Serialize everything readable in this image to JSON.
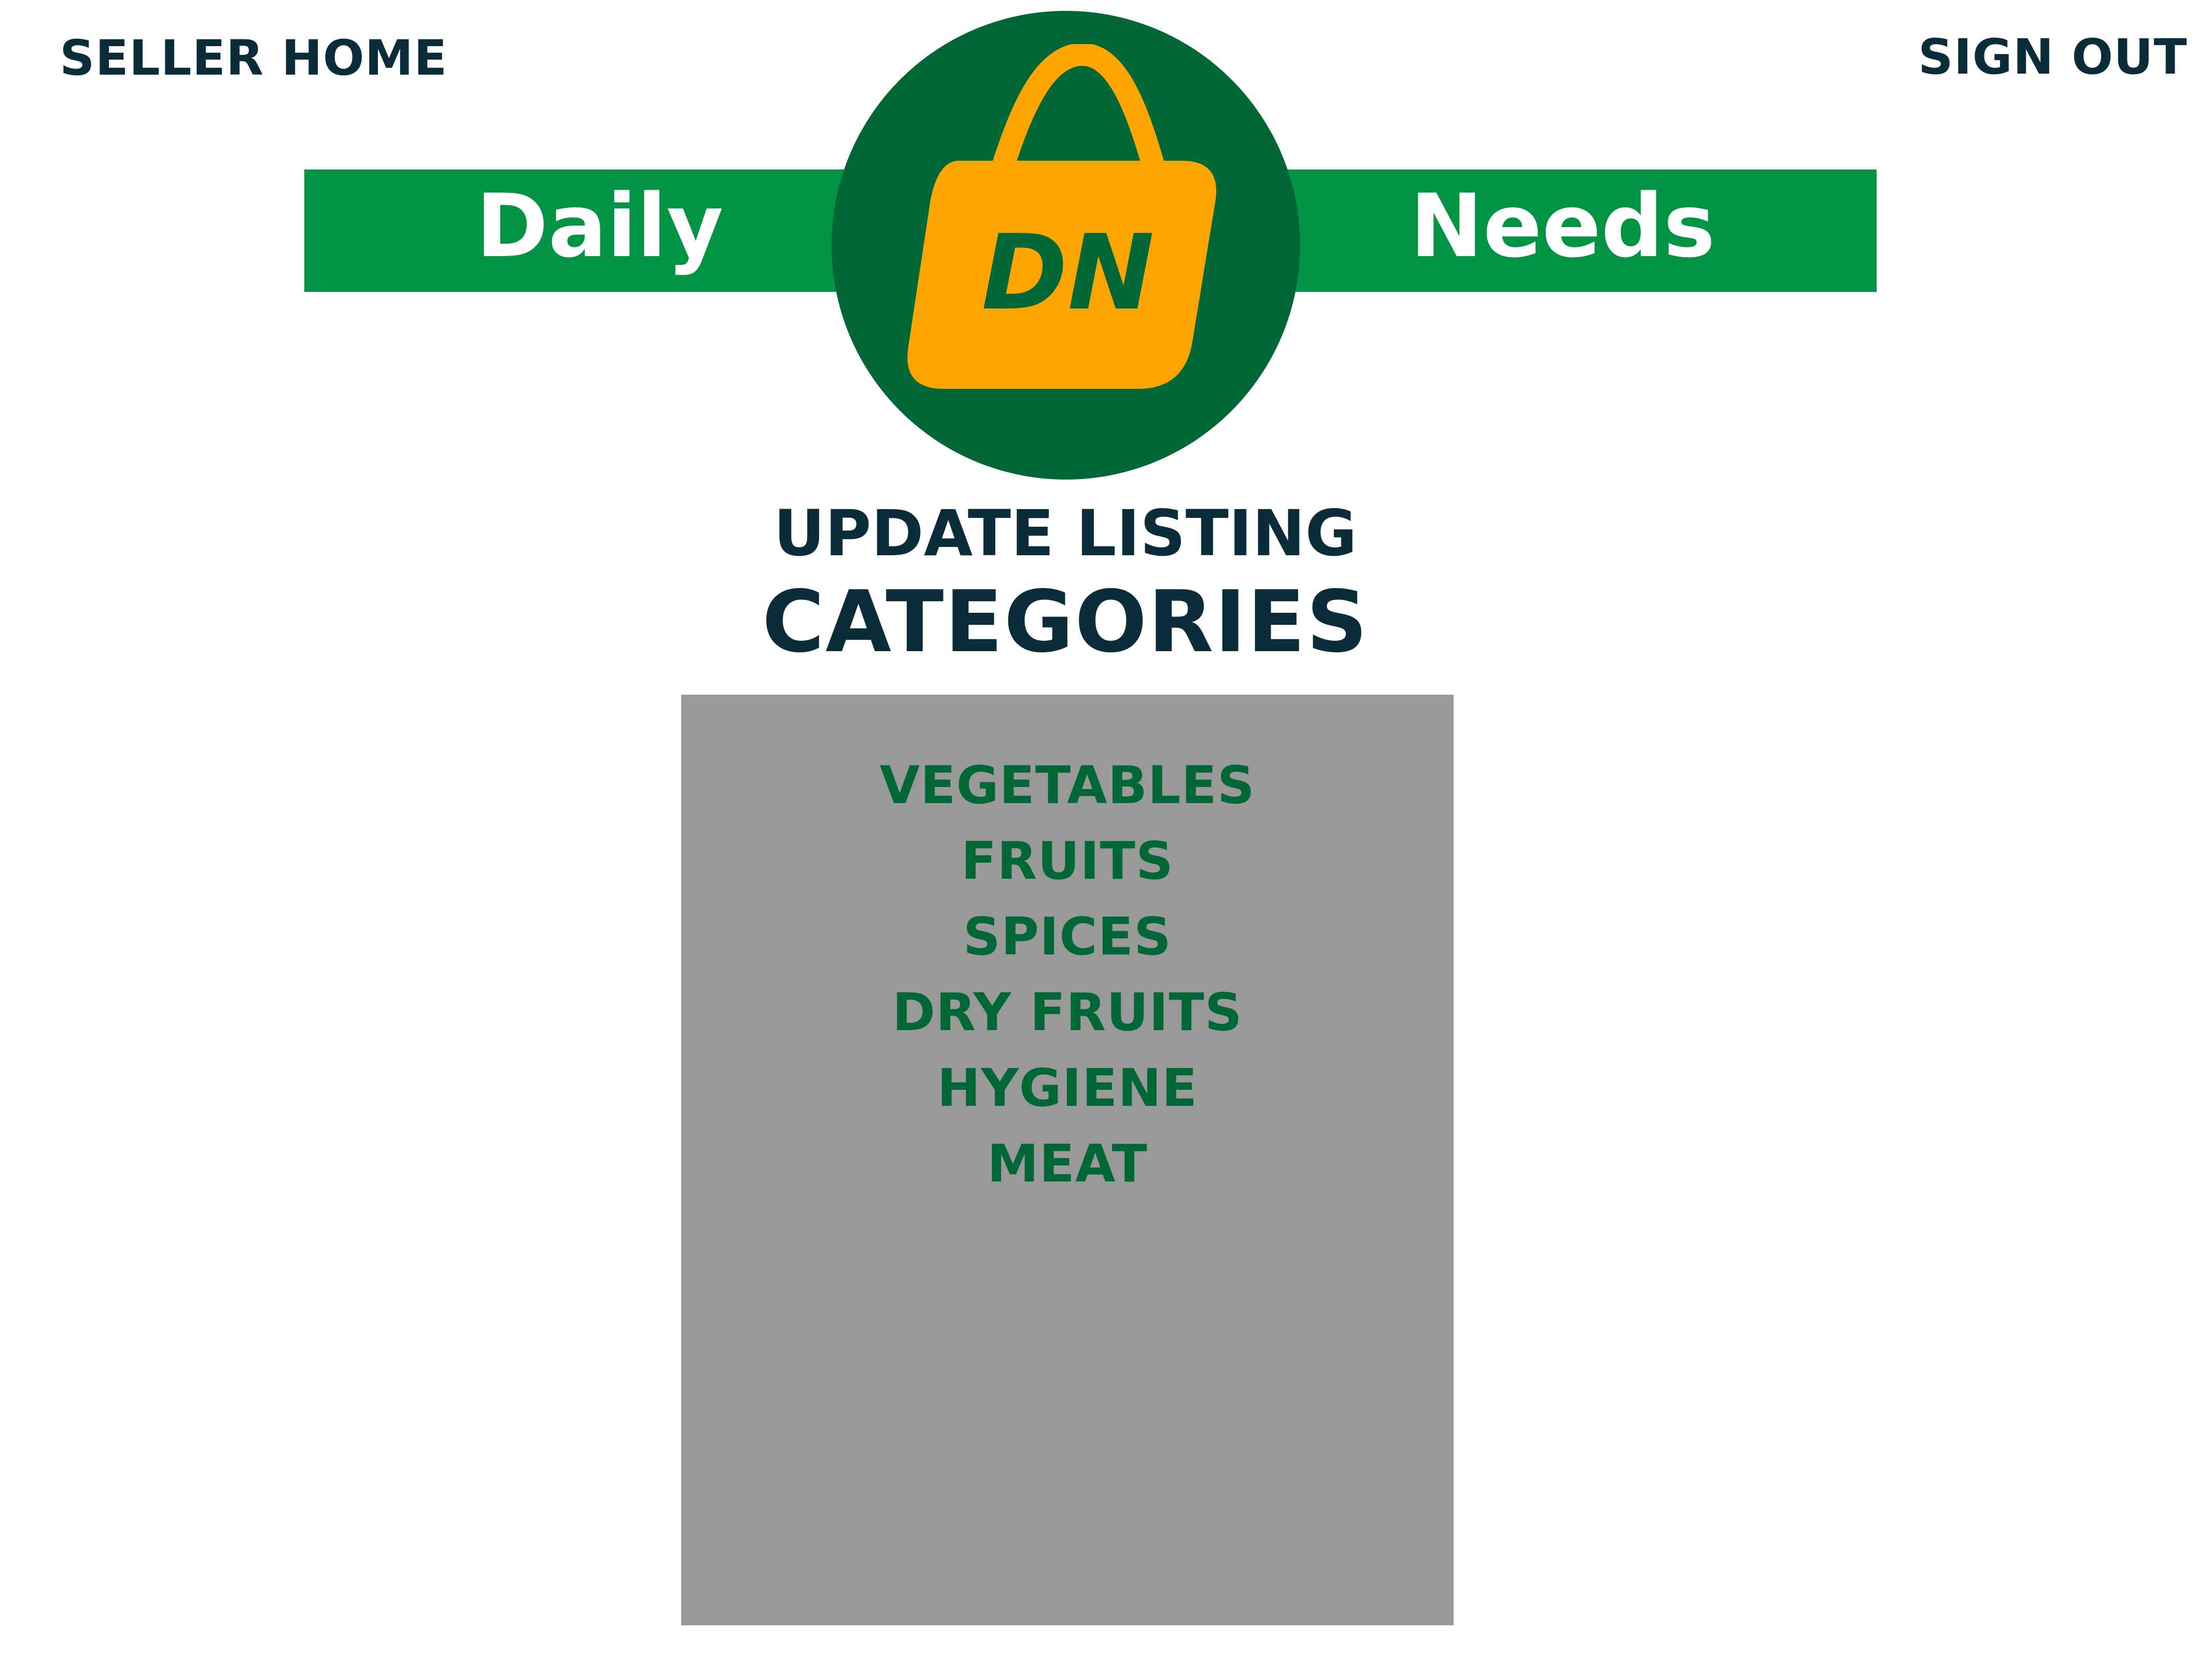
{
  "header": {
    "seller_home_label": "SELLER HOME",
    "sign_out_label": "SIGN OUT"
  },
  "brand": {
    "left_word": "Daily",
    "right_word": "Needs",
    "logo_initials": "DN",
    "colors": {
      "banner_green": "#009444",
      "circle_green": "#006837",
      "bag_orange": "#ffa500",
      "text_dark": "#0b2d3a"
    }
  },
  "page": {
    "title": "UPDATE LISTING",
    "subtitle": "CATEGORIES"
  },
  "categories": {
    "panel_color": "#999999",
    "items": [
      {
        "label": "VEGETABLES"
      },
      {
        "label": "FRUITS"
      },
      {
        "label": "SPICES"
      },
      {
        "label": "DRY FRUITS"
      },
      {
        "label": "HYGIENE"
      },
      {
        "label": "MEAT"
      }
    ]
  }
}
